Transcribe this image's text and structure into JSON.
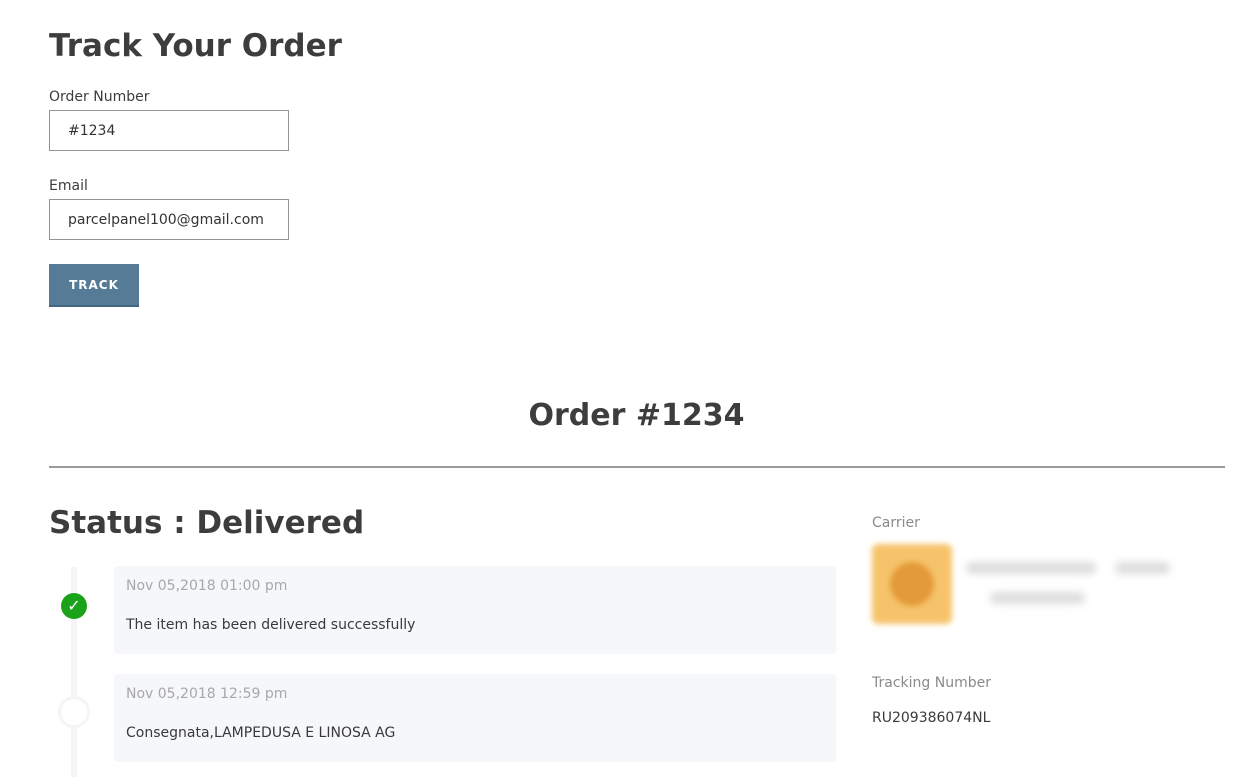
{
  "page_title": "Track Your Order",
  "form": {
    "order_label": "Order Number",
    "order_value": "#1234",
    "email_label": "Email",
    "email_value": "parcelpanel100@gmail.com",
    "track_button": "TRACK"
  },
  "order": {
    "title": "Order #1234",
    "status": "Status : Delivered",
    "events": [
      {
        "date": "Nov 05,2018 01:00 pm",
        "text": "The item has been delivered successfully"
      },
      {
        "date": "Nov 05,2018 12:59 pm",
        "text": "Consegnata,LAMPEDUSA E LINOSA AG"
      }
    ],
    "carrier_label": "Carrier",
    "tracking_label": "Tracking Number",
    "tracking_number": "RU209386074NL"
  },
  "colors": {
    "button": "#557b97",
    "success": "#1aa31a"
  }
}
